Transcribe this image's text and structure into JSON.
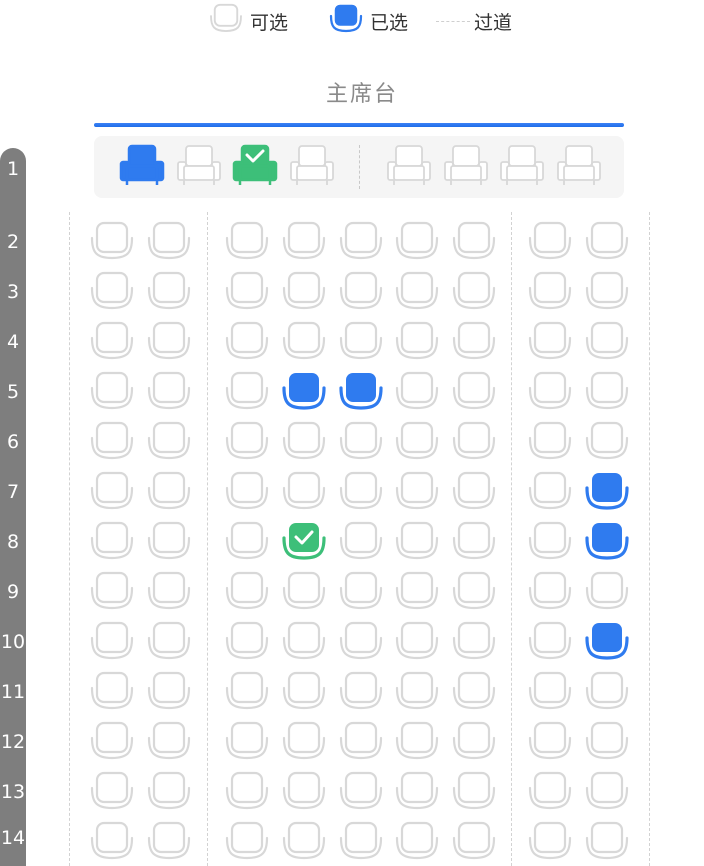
{
  "legend": [
    {
      "key": "available",
      "label": "可选"
    },
    {
      "key": "selected",
      "label": "已选"
    },
    {
      "key": "aisle",
      "label": "过道"
    }
  ],
  "stage": {
    "label": "主席台"
  },
  "colors": {
    "selected": "#2f7bef",
    "occupied": "#3dbf79",
    "available_outline": "#d8d8d8",
    "podium_bg": "#f5f5f5",
    "row_rail": "#7e7e7e",
    "stage_line": "#2f7bef"
  },
  "podium": {
    "left": [
      "selected",
      "available",
      "occupied",
      "available"
    ],
    "right": [
      "available",
      "available",
      "available",
      "available"
    ]
  },
  "rows": [
    {
      "label": "1"
    },
    {
      "label": "2"
    },
    {
      "label": "3"
    },
    {
      "label": "4"
    },
    {
      "label": "5"
    },
    {
      "label": "6"
    },
    {
      "label": "7"
    },
    {
      "label": "8"
    },
    {
      "label": "9"
    },
    {
      "label": "10"
    },
    {
      "label": "11"
    },
    {
      "label": "12"
    },
    {
      "label": "13"
    },
    {
      "label": "14"
    }
  ],
  "seat_grid": {
    "row_labels": [
      "2",
      "3",
      "4",
      "5",
      "6",
      "7",
      "8",
      "9",
      "10",
      "11",
      "12",
      "13",
      "14"
    ],
    "columns_per_block": [
      2,
      5,
      2
    ],
    "states": {
      "5": {
        "3": "selected",
        "4": "selected"
      },
      "7": {
        "8": "selected"
      },
      "8": {
        "3": "occupied",
        "8": "selected"
      },
      "10": {
        "8": "selected"
      }
    }
  }
}
